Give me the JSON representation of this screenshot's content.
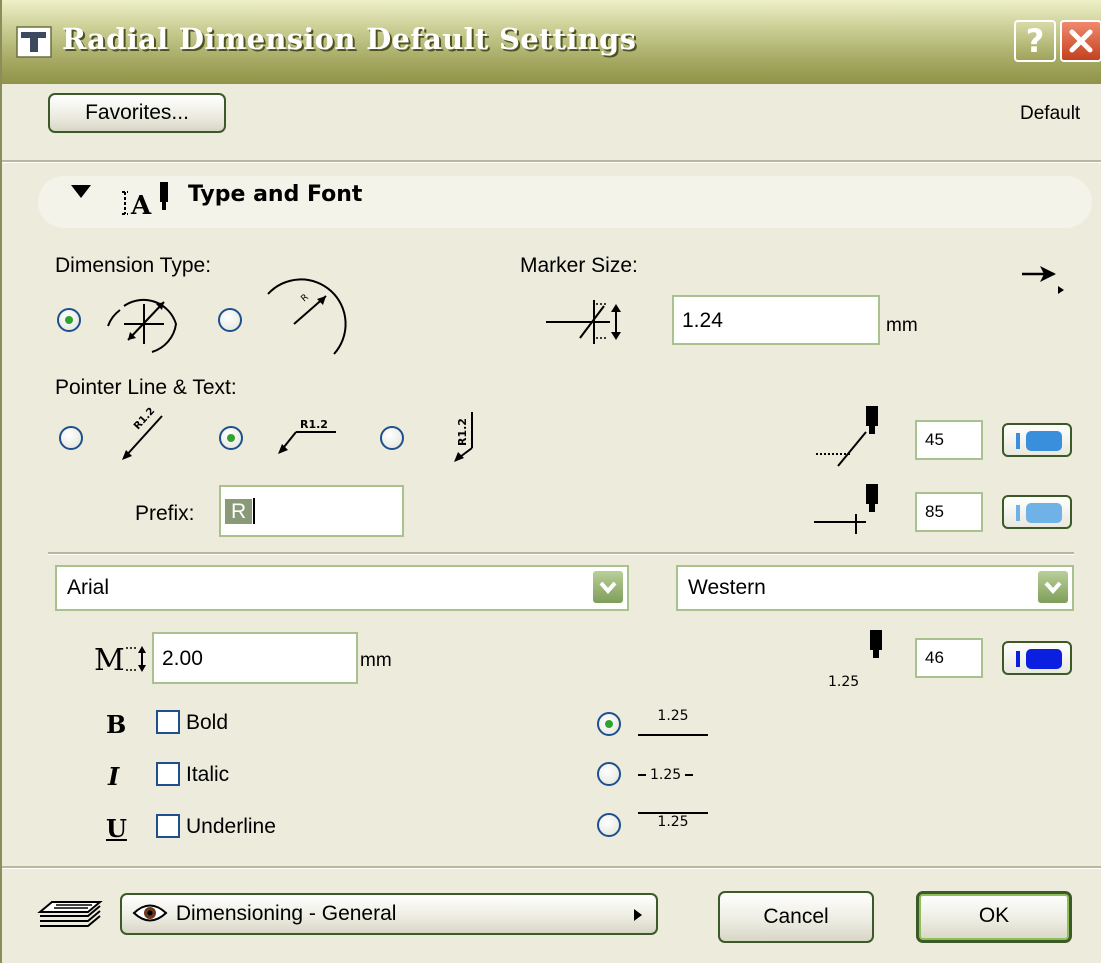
{
  "window": {
    "title": "Radial Dimension Default Settings",
    "help_glyph": "?"
  },
  "header": {
    "favorites_label": "Favorites...",
    "default_label": "Default"
  },
  "panel": {
    "title": "Type and Font"
  },
  "dimension_type": {
    "label": "Dimension Type:",
    "options": [
      "diameter",
      "radius"
    ],
    "selected_index": 0
  },
  "marker": {
    "label": "Marker Size:",
    "value": "1.24",
    "unit": "mm"
  },
  "pointer": {
    "label": "Pointer Line & Text:",
    "options": [
      {
        "glyph_text": "R1.2"
      },
      {
        "glyph_text": "R1.2"
      },
      {
        "glyph_text": "R1.2"
      }
    ],
    "selected_index": 1
  },
  "prefix": {
    "label": "Prefix:",
    "value": "R"
  },
  "pens": [
    {
      "number": "45",
      "color": "#3a8fdc"
    },
    {
      "number": "85",
      "color": "#6fb2e8"
    },
    {
      "number": "46",
      "color": "#0a1fe0"
    }
  ],
  "font": {
    "family": "Arial",
    "script": "Western",
    "size": "2.00",
    "unit": "mm",
    "sample_number": "1.25"
  },
  "styles": {
    "bold": {
      "glyph": "B",
      "label": "Bold",
      "checked": false
    },
    "italic": {
      "glyph": "I",
      "label": "Italic",
      "checked": false
    },
    "underline": {
      "glyph": "U",
      "label": "Underline",
      "checked": false
    }
  },
  "text_position": {
    "sample": "1.25",
    "selected_index": 0
  },
  "footer": {
    "layer": "Dimensioning - General",
    "cancel_label": "Cancel",
    "ok_label": "OK"
  }
}
